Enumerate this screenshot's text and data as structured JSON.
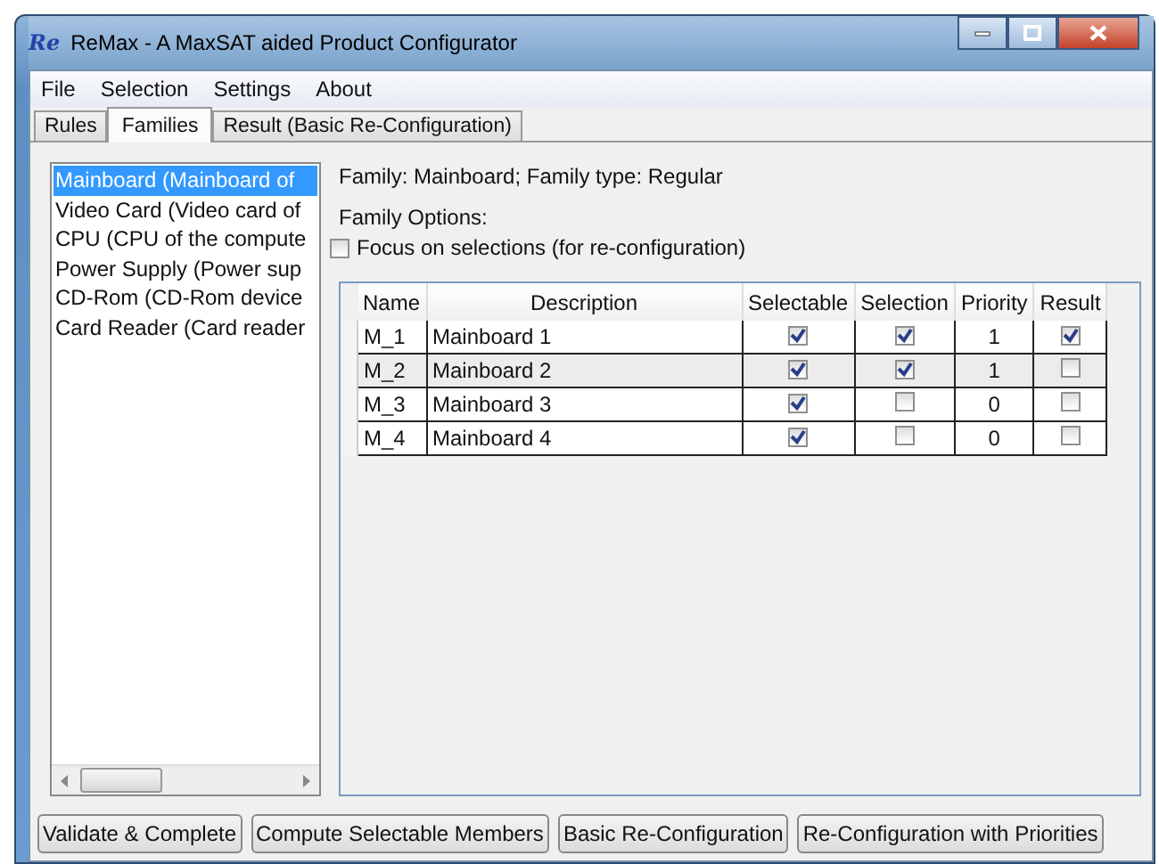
{
  "window": {
    "title": "ReMax - A MaxSAT aided Product Configurator",
    "logo": "Re"
  },
  "menu": [
    "File",
    "Selection",
    "Settings",
    "About"
  ],
  "tabs": [
    {
      "label": "Rules",
      "selected": false
    },
    {
      "label": "Families",
      "selected": true
    },
    {
      "label": "Result (Basic Re-Configuration)",
      "selected": false
    }
  ],
  "families": [
    {
      "label": "Mainboard  (Mainboard of",
      "selected": true
    },
    {
      "label": "Video Card  (Video card of",
      "selected": false
    },
    {
      "label": "CPU  (CPU of the compute",
      "selected": false
    },
    {
      "label": "Power Supply  (Power sup",
      "selected": false
    },
    {
      "label": "CD-Rom  (CD-Rom device",
      "selected": false
    },
    {
      "label": "Card Reader  (Card reader",
      "selected": false
    }
  ],
  "family_info": "Family: Mainboard;  Family type: Regular",
  "options_label": "Family Options:",
  "focus_option": {
    "label": "Focus on selections (for re-configuration)",
    "checked": false
  },
  "table": {
    "columns": [
      "Name",
      "Description",
      "Selectable",
      "Selection",
      "Priority",
      "Result"
    ],
    "rows": [
      {
        "name": "M_1",
        "description": "Mainboard 1",
        "selectable": true,
        "selection": true,
        "priority": "1",
        "result": true,
        "selected": false
      },
      {
        "name": "M_2",
        "description": "Mainboard 2",
        "selectable": true,
        "selection": true,
        "priority": "1",
        "result": false,
        "selected": true
      },
      {
        "name": "M_3",
        "description": "Mainboard 3",
        "selectable": true,
        "selection": false,
        "priority": "0",
        "result": false,
        "selected": false
      },
      {
        "name": "M_4",
        "description": "Mainboard 4",
        "selectable": true,
        "selection": false,
        "priority": "0",
        "result": false,
        "selected": false
      }
    ]
  },
  "buttons": [
    "Validate & Complete",
    "Compute Selectable Members",
    "Basic Re-Configuration",
    "Re-Configuration with Priorities"
  ]
}
